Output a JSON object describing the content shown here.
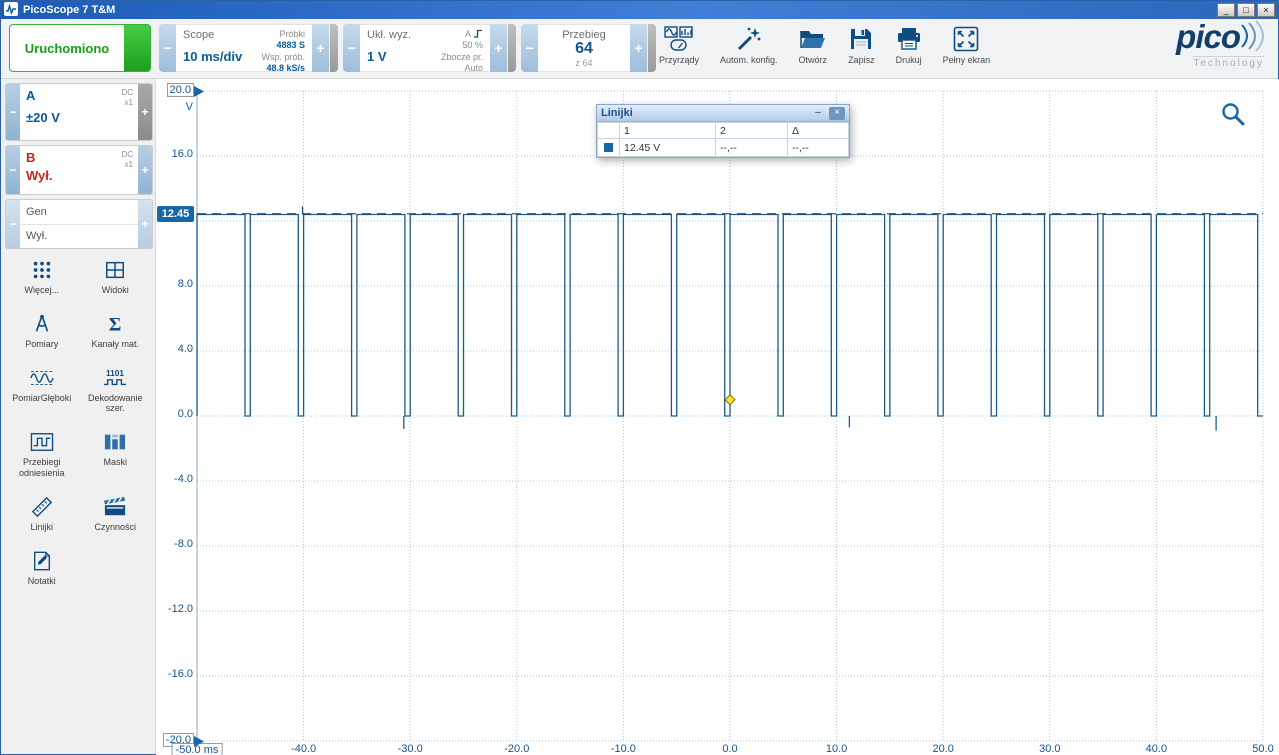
{
  "window": {
    "title": "PicoScope 7 T&M",
    "minimize": "_",
    "restore": "□",
    "close": "×"
  },
  "ui": {
    "minus": "−",
    "plus": "+"
  },
  "toolbar": {
    "run_button": "Uruchomiono",
    "scope": {
      "title": "Scope",
      "timebase": "10 ms/div",
      "samples_label": "Próbki",
      "samples_value": "4883 S",
      "rate_label": "Wsp. prób.",
      "rate_value": "48.8 kS/s"
    },
    "trigger": {
      "title": "Ukł. wyz.",
      "level": "1 V",
      "source": "A",
      "threshold_pct": "50 %",
      "edge": "Zbocze pr.",
      "mode": "Auto"
    },
    "waveform_nav": {
      "title": "Przebieg",
      "current": "64",
      "total": "z 64"
    },
    "buttons": [
      {
        "label": "Przyrządy"
      },
      {
        "label": "Autom. konfig."
      },
      {
        "label": "Otwórz"
      },
      {
        "label": "Zapisz"
      },
      {
        "label": "Drukuj"
      },
      {
        "label": "Pełny ekran"
      }
    ],
    "brand": {
      "name": "pico",
      "tagline": "Technology"
    }
  },
  "sidebar": {
    "channel_a": {
      "name": "A",
      "coupling": "DC",
      "probe": "x1",
      "range": "±20 V"
    },
    "channel_b": {
      "name": "B",
      "coupling": "DC",
      "probe": "x1",
      "status": "Wył."
    },
    "generator": {
      "name": "Gen",
      "status": "Wył."
    },
    "tools": [
      {
        "label": "Więcej..."
      },
      {
        "label": "Widoki"
      },
      {
        "label": "Pomiary"
      },
      {
        "label": "Kanały mat."
      },
      {
        "label": "PomiarGłęboki"
      },
      {
        "label": "Dekodowanie szer."
      },
      {
        "label": "Przebiegi odniesienia"
      },
      {
        "label": "Maski"
      },
      {
        "label": "Linijki"
      },
      {
        "label": "Czynności"
      },
      {
        "label": "Notatki"
      }
    ]
  },
  "rulers_window": {
    "title": "Linijki",
    "minimize": "–",
    "close": "×",
    "columns": [
      "1",
      "2",
      "Δ"
    ],
    "row": {
      "ruler1": "12.45 V",
      "ruler2": "--,--",
      "delta": "--,--"
    },
    "swatch_color": "#1766a6"
  },
  "chart_data": {
    "type": "line",
    "x_unit": "ms",
    "y_unit": "V",
    "xlim": [
      -50,
      50
    ],
    "ylim": [
      -20,
      20
    ],
    "grid": true,
    "x_ticks": [
      -50,
      -40,
      -30,
      -20,
      -10,
      0,
      10,
      20,
      30,
      40,
      50
    ],
    "x_tick_labels": [
      "-50.0 ms",
      "-40.0",
      "-30.0",
      "-20.0",
      "-10.0",
      "0.0",
      "10.0",
      "20.0",
      "30.0",
      "40.0",
      "50.0"
    ],
    "y_ticks": [
      20,
      16,
      12,
      8,
      4,
      0,
      -4,
      -8,
      -12,
      -16,
      -20
    ],
    "y_tick_labels": [
      "20.0",
      "16.0",
      "12.0",
      "8.0",
      "4.0",
      "0.0",
      "-4.0",
      "-8.0",
      "-12.0",
      "-16.0",
      "-20.0"
    ],
    "series": [
      {
        "name": "A",
        "color": "#1a5a8c",
        "shape": "pulse",
        "high_v": 12.4,
        "low_v": 0,
        "period_ms": 5,
        "low_time_ms": 0.5,
        "rising_edge_at_ms": 0,
        "glitches": [
          {
            "t": -40.1,
            "from": 12.4,
            "to": 12.9
          },
          {
            "t": -30.6,
            "from": 0,
            "to": -0.8
          },
          {
            "t": 11.2,
            "from": 0,
            "to": -0.7
          },
          {
            "t": 45.6,
            "from": 0,
            "to": -0.9
          }
        ]
      }
    ],
    "ruler": {
      "value": 12.45,
      "label": "12.45"
    },
    "marker": {
      "x": 0,
      "y": 1
    }
  }
}
